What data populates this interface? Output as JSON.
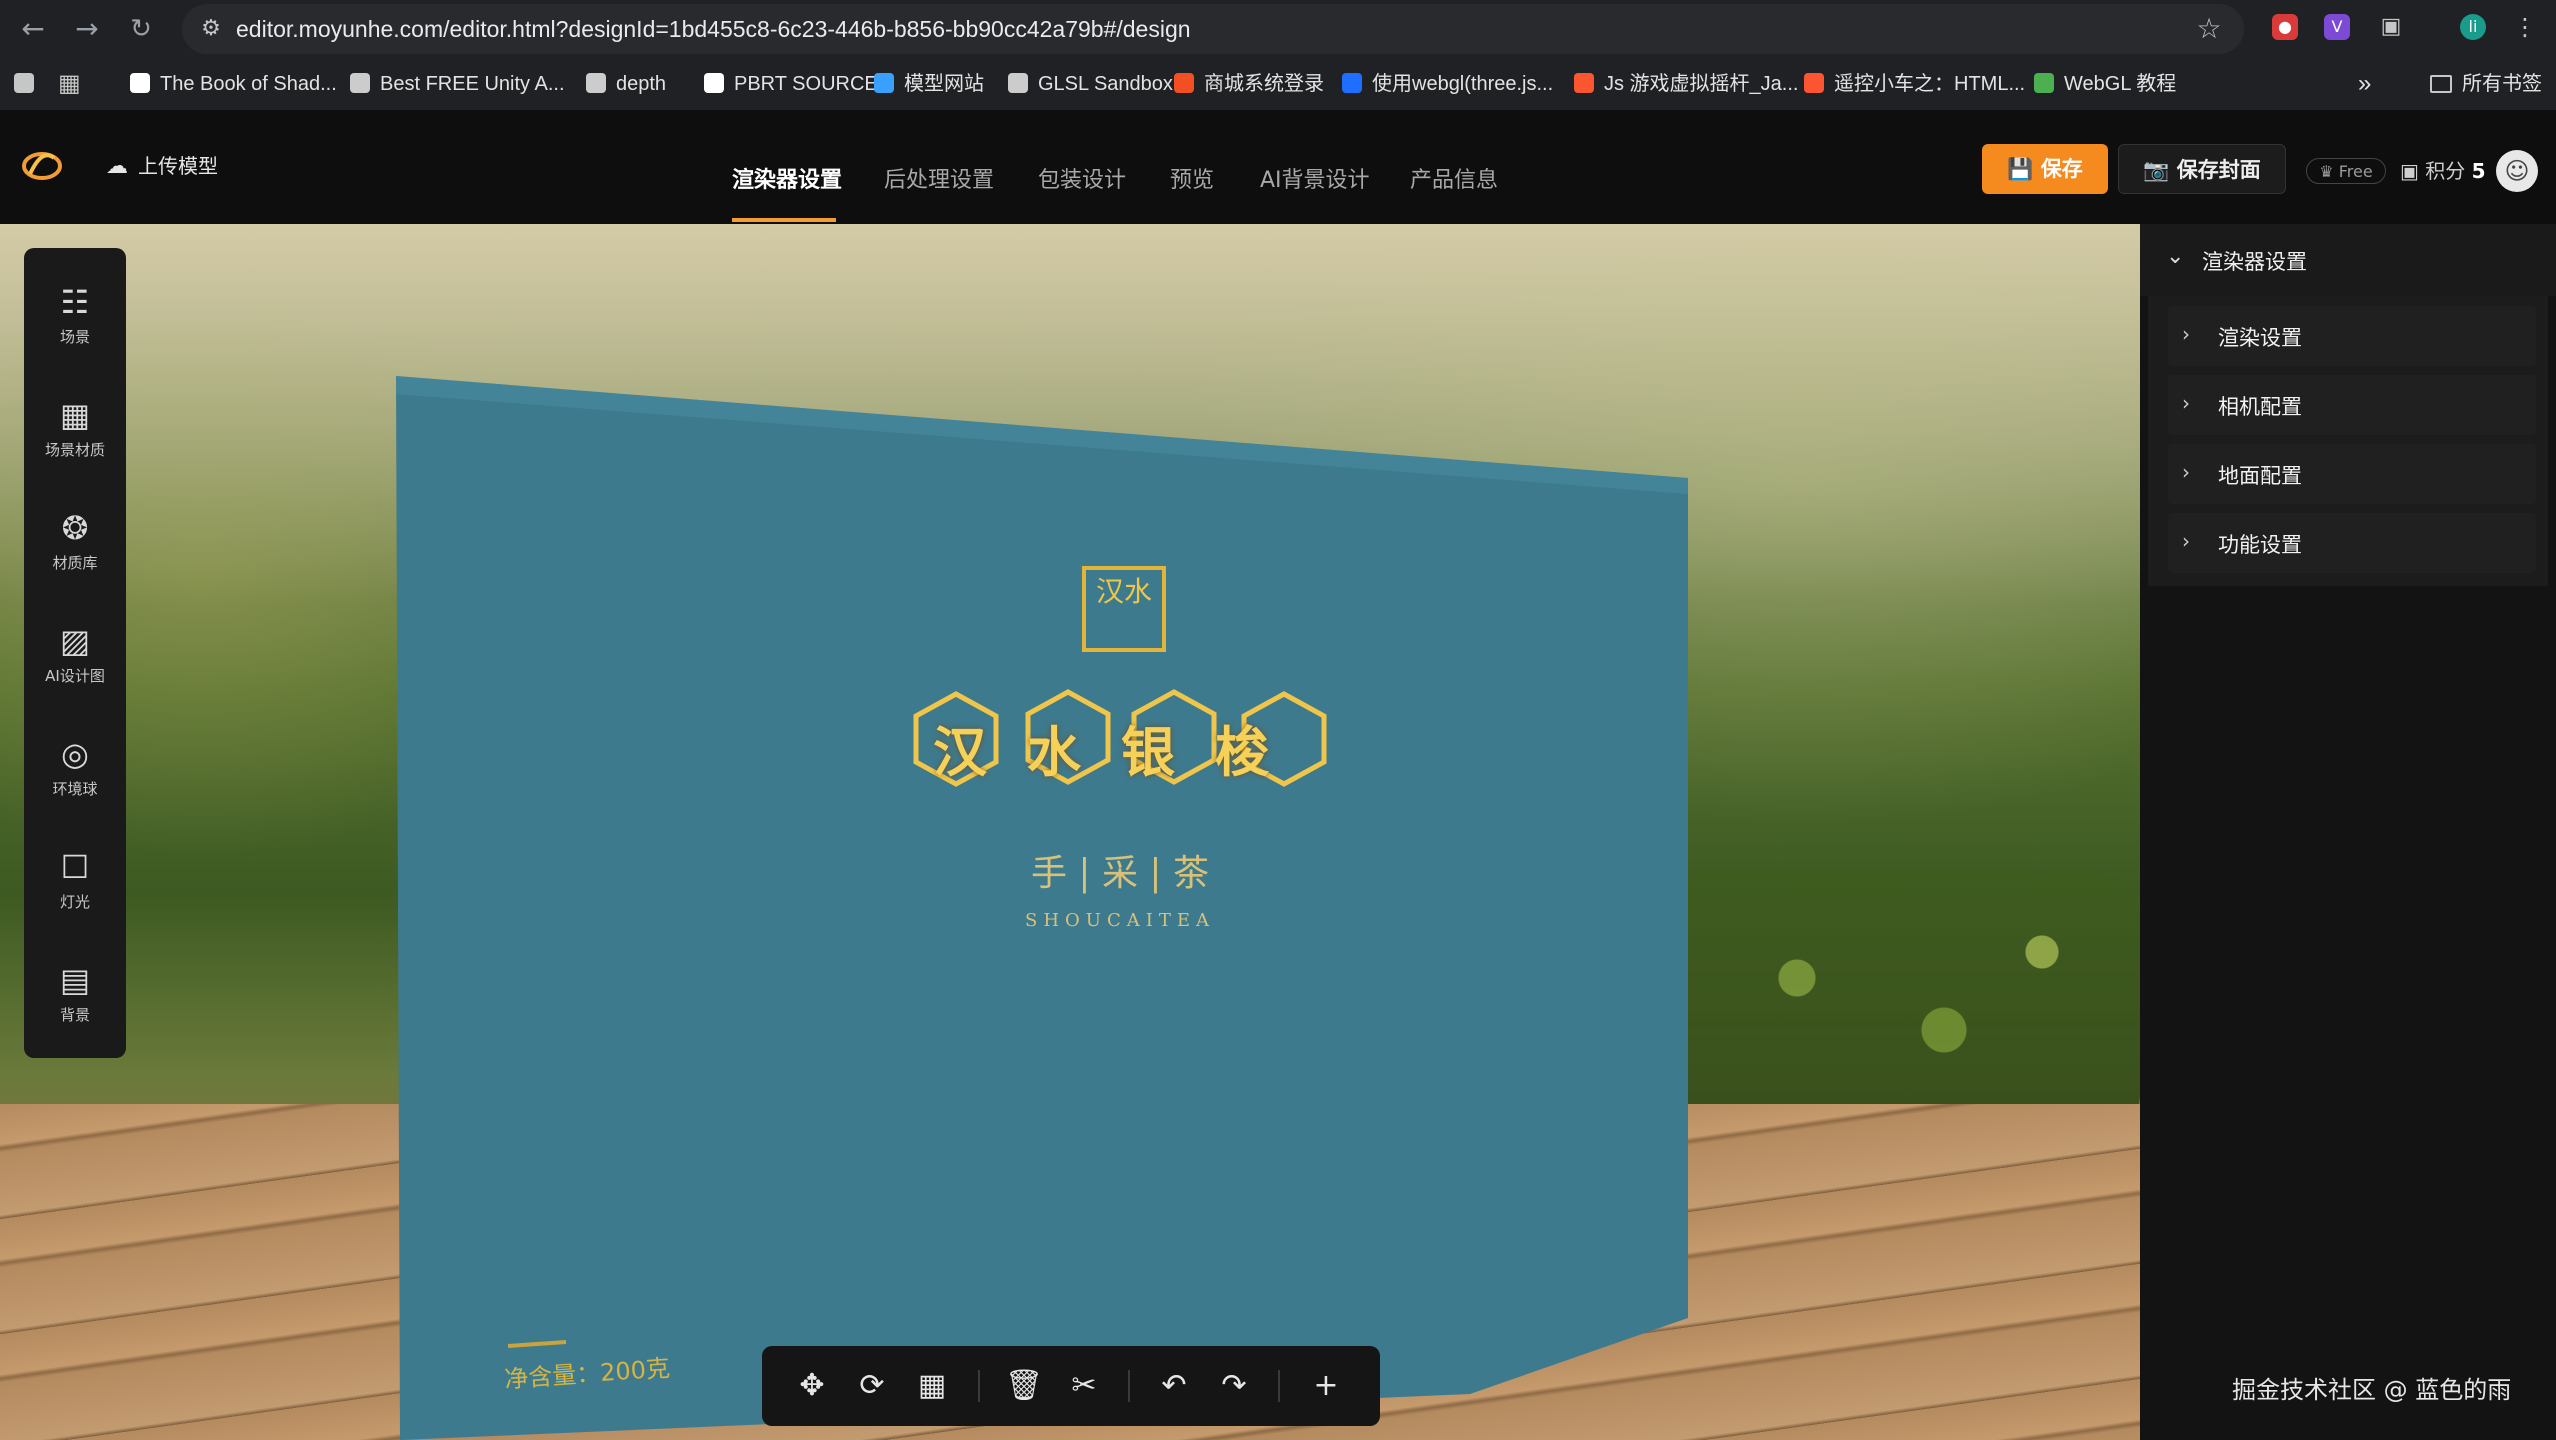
{
  "browser": {
    "url": "editor.moyunhe.com/editor.html?designId=1bd455c8-6c23-446b-b856-bb90cc42a79b#/design",
    "bookmarks": [
      {
        "label": "The Book of Shad...",
        "icon": "plus-icon",
        "color": "#ffffff"
      },
      {
        "label": "Best FREE Unity A...",
        "icon": "globe-icon",
        "color": "#cccccc"
      },
      {
        "label": "depth",
        "icon": "diamond-icon",
        "color": "#cccccc"
      },
      {
        "label": "PBRT SOURCE",
        "icon": "github-icon",
        "color": "#ffffff"
      },
      {
        "label": "模型网站",
        "icon": "cube-icon",
        "color": "#3aa0ff"
      },
      {
        "label": "GLSL Sandbox",
        "icon": "globe-icon",
        "color": "#cccccc"
      },
      {
        "label": "商城系统登录",
        "icon": "windows-icon",
        "color": "#f25022"
      },
      {
        "label": "使用webgl(three.js...",
        "icon": "circle-icon",
        "color": "#1e6fff"
      },
      {
        "label": "Js 游戏虚拟摇杆_Ja...",
        "icon": "csdn-icon",
        "color": "#fc5531"
      },
      {
        "label": "遥控小车之：HTML...",
        "icon": "csdn-icon",
        "color": "#fc5531"
      },
      {
        "label": "WebGL 教程",
        "icon": "globe-color-icon",
        "color": "#4caf50"
      }
    ],
    "all_bookmarks": "所有书签",
    "more": "»"
  },
  "header": {
    "upload_label": "上传模型",
    "tabs": [
      "渲染器设置",
      "后处理设置",
      "包装设计",
      "预览",
      "AI背景设计",
      "产品信息"
    ],
    "active_tab": "渲染器设置",
    "save_label": "保存",
    "save_cover_label": "保存封面",
    "plan_badge": "Free",
    "points_label": "积分",
    "points_value": "5",
    "accent_color": "#f58a1f"
  },
  "left_tools": [
    {
      "label": "场景",
      "icon": "scene-tree-icon"
    },
    {
      "label": "场景材质",
      "icon": "grid-icon"
    },
    {
      "label": "材质库",
      "icon": "paint-bucket-icon"
    },
    {
      "label": "AI设计图",
      "icon": "image-icon"
    },
    {
      "label": "环境球",
      "icon": "globe-icon"
    },
    {
      "label": "灯光",
      "icon": "bulb-icon"
    },
    {
      "label": "背景",
      "icon": "background-icon"
    }
  ],
  "product": {
    "seal_text": "汉水",
    "brand": "汉水银梭",
    "tagline": "手 | 采 | 茶",
    "tagline_en": "SHOUCAITEA",
    "net_weight": "净含量：200克"
  },
  "bottom_toolbar": [
    "move-icon",
    "rotate-icon",
    "scale-icon",
    "delete-icon",
    "crop-icon",
    "undo-icon",
    "redo-icon",
    "add-icon"
  ],
  "right_panel": {
    "title": "渲染器设置",
    "items": [
      "渲染设置",
      "相机配置",
      "地面配置",
      "功能设置"
    ]
  },
  "watermark": "掘金技术社区 @ 蓝色的雨"
}
